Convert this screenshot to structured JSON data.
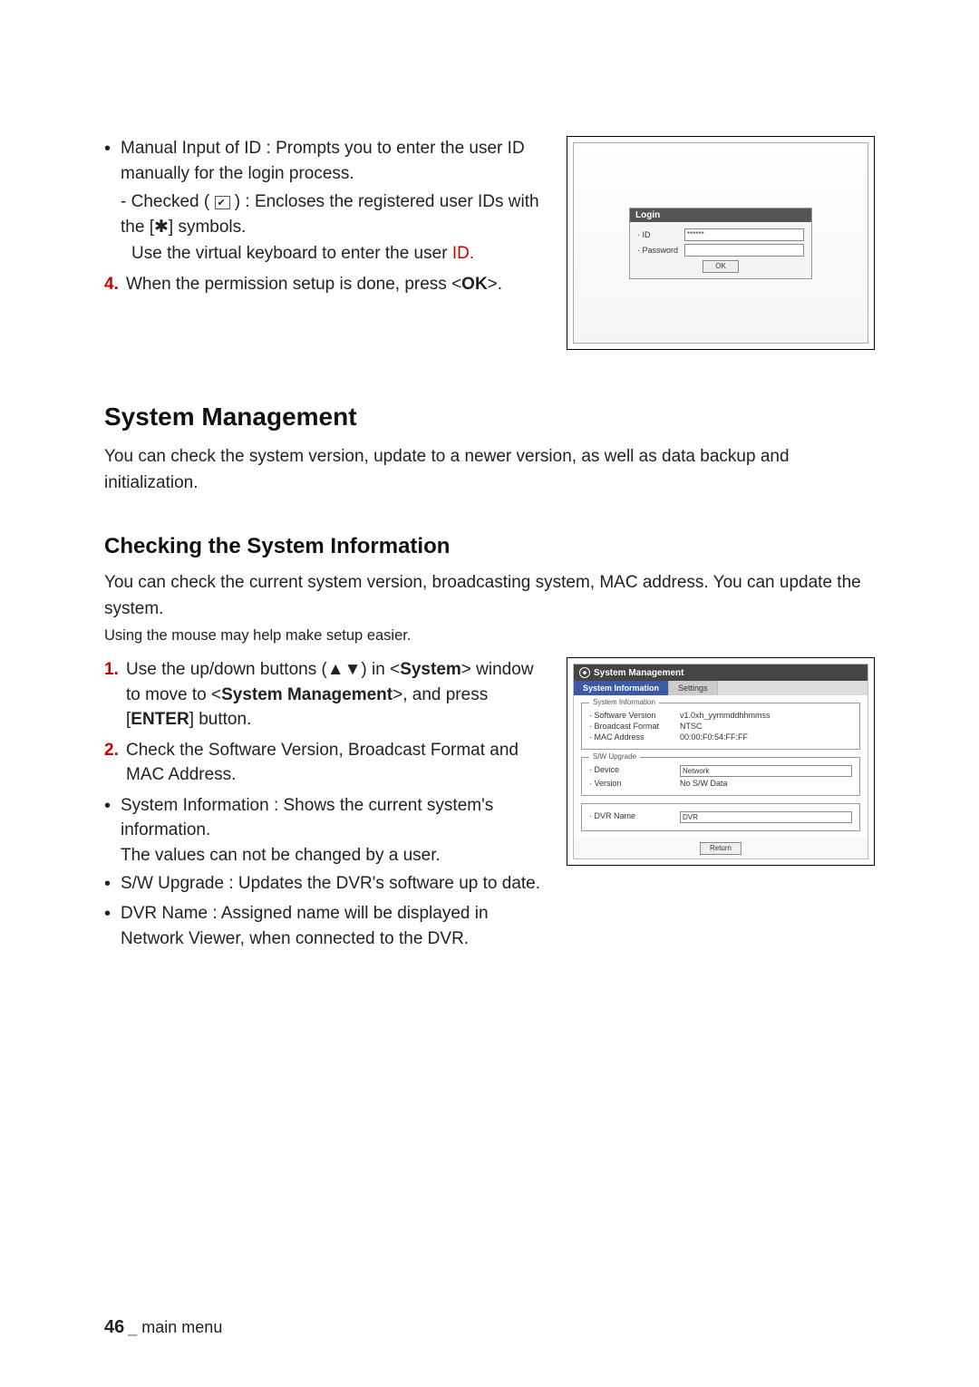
{
  "top": {
    "bullet": "Manual Input of ID : Prompts you to enter the user ID manually for the login process.",
    "sub": "Checked (",
    "sub2": ") : Encloses the registered user IDs with the [✱] symbols.",
    "sub_line2a": "Use the virtual keyboard to enter the user ",
    "sub_line2b": "ID.",
    "step4_pre": "4.",
    "step4": "When the permission setup is done, press <",
    "step4_b": "OK",
    "step4_post": ">.",
    "login": {
      "title": "Login",
      "id_label": "· ID",
      "id_value": "******",
      "pw_label": "· Password",
      "ok": "OK"
    }
  },
  "sysmgmt": {
    "heading": "System Management",
    "intro": "You can check the system version, update to a newer version, as well as data backup and initialization.",
    "check_heading": "Checking the System Information",
    "check_intro": "You can check the current system version, broadcasting system, MAC address. You can update the system.",
    "mouse_tip": "Using the mouse may help make setup easier.",
    "step1_num": "1.",
    "step1a": "Use the up/down buttons (▲▼) in <",
    "step1b": "System",
    "step1c": "> window to move to <",
    "step1d": "System Management",
    "step1e": ">, and press [",
    "step1f": "ENTER",
    "step1g": "] button.",
    "step2_num": "2.",
    "step2": "Check the Software Version, Broadcast Format and MAC Address.",
    "b_sysinfo": "System Information : Shows the current system's information.",
    "b_sysinfo2": "The values can not be changed by a user.",
    "b_sw": "S/W Upgrade : Updates the DVR's software up to date.",
    "b_dvr": "DVR Name : Assigned name will be displayed in Network Viewer, when connected to the DVR.",
    "screenshot": {
      "header": "System Management",
      "tab1": "System Information",
      "tab2": "Settings",
      "grp1": "System Information",
      "sw_ver_k": "· Software Version",
      "sw_ver_v": "v1.0xh_yymmddhhmmss",
      "bc_k": "· Broadcast Format",
      "bc_v": "NTSC",
      "mac_k": "· MAC Address",
      "mac_v": "00:00:F0:54:FF:FF",
      "grp2": "S/W Upgrade",
      "dev_k": "· Device",
      "dev_v": "Network",
      "ver_k": "· Version",
      "ver_v": "No S/W Data",
      "grp3_k": "· DVR Name",
      "grp3_v": "DVR"
    }
  },
  "footer": {
    "page": "46",
    "sep": "_",
    "label": "main menu"
  }
}
